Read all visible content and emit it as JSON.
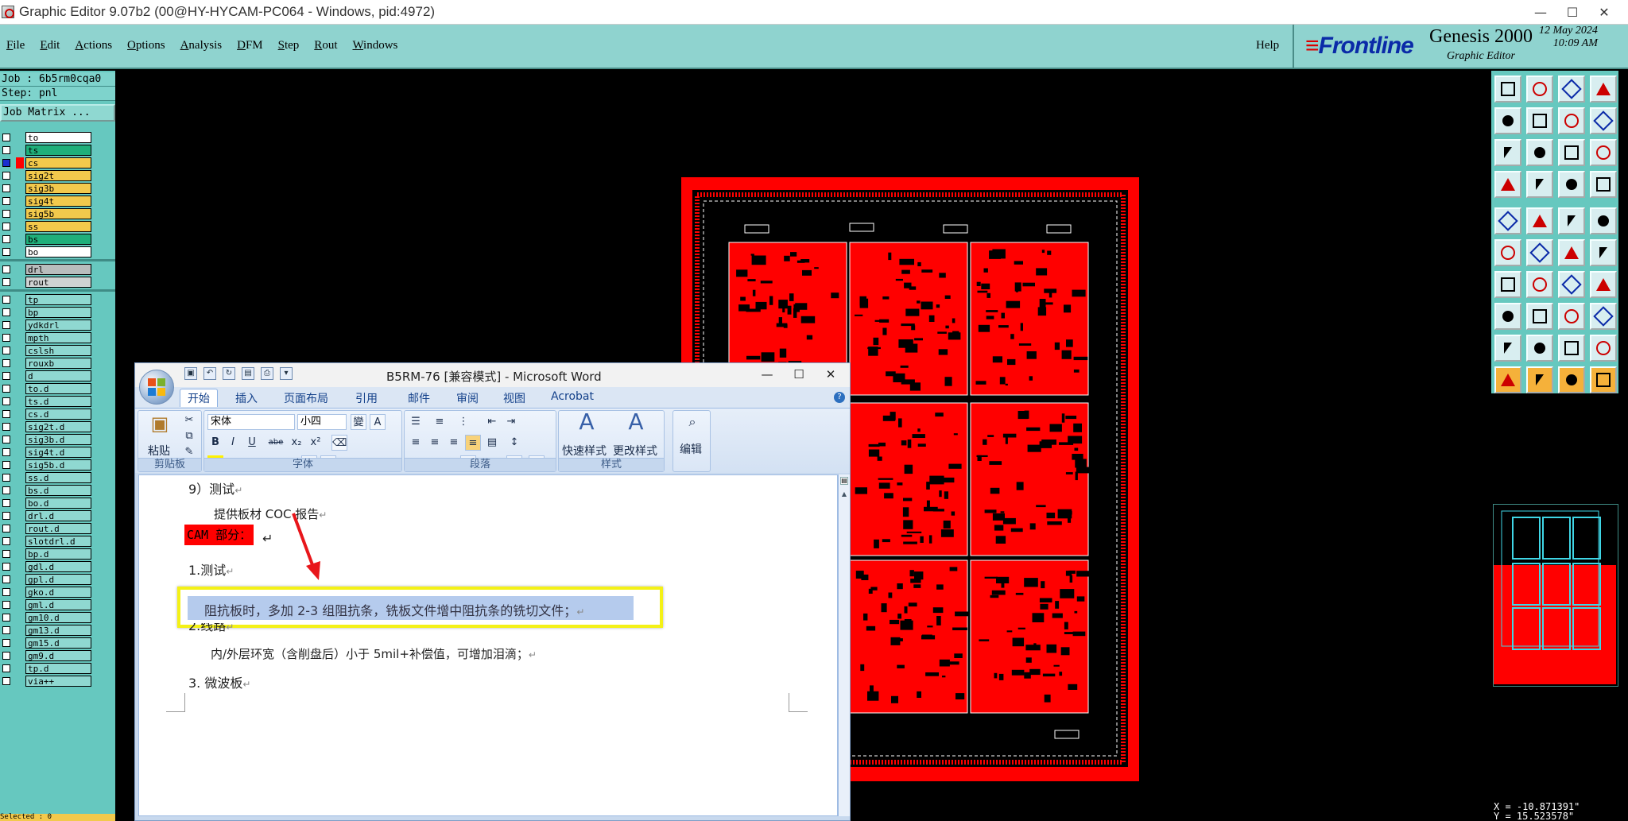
{
  "window": {
    "title": "Graphic Editor 9.07b2 (00@HY-HYCAM-PC064 - Windows, pid:4972)",
    "minimize": "—",
    "maximize": "☐",
    "close": "✕"
  },
  "menu": [
    "File",
    "Edit",
    "Actions",
    "Options",
    "Analysis",
    "DFM",
    "Step",
    "Rout",
    "Windows"
  ],
  "help": "Help",
  "brand": {
    "logo": "Frontline",
    "product": "Genesis 2000",
    "subtitle": "Graphic Editor",
    "date": "12 May 2024",
    "time": "10:09 AM"
  },
  "job": {
    "job_line": "Job : 6b5rm0cqa0",
    "step_line": "Step: pnl",
    "matrix_button": "Job Matrix ..."
  },
  "layers": [
    {
      "name": "to",
      "color": "#ffffff",
      "on": false
    },
    {
      "name": "ts",
      "color": "#1faf7a",
      "on": false
    },
    {
      "name": "cs",
      "color": "#f2c94c",
      "on": true,
      "marker": "#ff0000"
    },
    {
      "name": "sig2t",
      "color": "#f2c94c",
      "on": false
    },
    {
      "name": "sig3b",
      "color": "#f2c94c",
      "on": false
    },
    {
      "name": "sig4t",
      "color": "#f2c94c",
      "on": false
    },
    {
      "name": "sig5b",
      "color": "#f2c94c",
      "on": false
    },
    {
      "name": "ss",
      "color": "#f2c94c",
      "on": false
    },
    {
      "name": "bs",
      "color": "#1faf7a",
      "on": false
    },
    {
      "name": "bo",
      "color": "#ffffff",
      "on": false
    },
    {
      "name": "drl",
      "color": "#b9bdbd",
      "on": false
    },
    {
      "name": "rout",
      "color": "#cfd3d3",
      "on": false
    },
    {
      "name": "tp",
      "color": "#8fd8d1",
      "on": false
    },
    {
      "name": "bp",
      "color": "#8fd8d1",
      "on": false
    },
    {
      "name": "ydkdrl",
      "color": "#8fd8d1",
      "on": false
    },
    {
      "name": "mpth",
      "color": "#8fd8d1",
      "on": false
    },
    {
      "name": "cslsh",
      "color": "#8fd8d1",
      "on": false
    },
    {
      "name": "rouxb",
      "color": "#8fd8d1",
      "on": false
    },
    {
      "name": "d",
      "color": "#8fd8d1",
      "on": false
    },
    {
      "name": "to.d",
      "color": "#8fd8d1",
      "on": false
    },
    {
      "name": "ts.d",
      "color": "#8fd8d1",
      "on": false
    },
    {
      "name": "cs.d",
      "color": "#8fd8d1",
      "on": false
    },
    {
      "name": "sig2t.d",
      "color": "#8fd8d1",
      "on": false
    },
    {
      "name": "sig3b.d",
      "color": "#8fd8d1",
      "on": false
    },
    {
      "name": "sig4t.d",
      "color": "#8fd8d1",
      "on": false
    },
    {
      "name": "sig5b.d",
      "color": "#8fd8d1",
      "on": false
    },
    {
      "name": "ss.d",
      "color": "#8fd8d1",
      "on": false
    },
    {
      "name": "bs.d",
      "color": "#8fd8d1",
      "on": false
    },
    {
      "name": "bo.d",
      "color": "#8fd8d1",
      "on": false
    },
    {
      "name": "drl.d",
      "color": "#8fd8d1",
      "on": false
    },
    {
      "name": "rout.d",
      "color": "#8fd8d1",
      "on": false
    },
    {
      "name": "slotdrl.d",
      "color": "#8fd8d1",
      "on": false
    },
    {
      "name": "bp.d",
      "color": "#8fd8d1",
      "on": false
    },
    {
      "name": "gdl.d",
      "color": "#8fd8d1",
      "on": false
    },
    {
      "name": "gpl.d",
      "color": "#8fd8d1",
      "on": false
    },
    {
      "name": "gko.d",
      "color": "#8fd8d1",
      "on": false
    },
    {
      "name": "gml.d",
      "color": "#8fd8d1",
      "on": false
    },
    {
      "name": "gm10.d",
      "color": "#8fd8d1",
      "on": false
    },
    {
      "name": "gm13.d",
      "color": "#8fd8d1",
      "on": false
    },
    {
      "name": "gm15.d",
      "color": "#8fd8d1",
      "on": false
    },
    {
      "name": "gm9.d",
      "color": "#8fd8d1",
      "on": false
    },
    {
      "name": "tp.d",
      "color": "#8fd8d1",
      "on": false
    },
    {
      "name": "via++",
      "color": "#8fd8d1",
      "on": false
    }
  ],
  "selected_line": "Selected : 0",
  "coords": {
    "x": "X = -10.871391\"",
    "y": "Y = 15.523578\""
  },
  "toolbar_icons": [
    "home-icon",
    "open-icon",
    "house-icon",
    "window-icon",
    "import-icon",
    "export-icon",
    "input-icon",
    "script-icon",
    "zoom-fit-icon",
    "pan-icon",
    "scale-icon",
    "query-icon",
    "snap-icon",
    "grid-icon",
    "measure-icon",
    "measure-icon-2",
    "record-icon",
    "frame-icon",
    "film-icon",
    "dot-icon",
    "connect-icon",
    "cross-icon",
    "route-icon",
    "route-icon-2",
    "line-icon",
    "slash-icon",
    "arc-icon",
    "text-icon",
    "pad-icon",
    "minus-icon",
    "mirror-icon",
    "array-icon",
    "triangle-icon",
    "triangle-a-icon",
    "triangle-b-icon",
    "triangle-c-icon",
    "pointer-icon",
    "pointer-2-icon",
    "pointer-3-icon",
    "pointer-4-icon"
  ],
  "word": {
    "caption": "B5RM-76 [兼容模式] - Microsoft Word",
    "tabs": [
      "开始",
      "插入",
      "页面布局",
      "引用",
      "邮件",
      "审阅",
      "视图",
      "Acrobat"
    ],
    "groups": {
      "clipboard": "剪贴板",
      "font": "字体",
      "paragraph": "段落",
      "styles": "样式",
      "edit": "编辑"
    },
    "paste_label": "粘贴",
    "font_name": "宋体",
    "font_size": "小四",
    "quick_styles": "快速样式",
    "change_styles": "更改样式",
    "edit_label": "编辑",
    "format_buttons": [
      "B",
      "I",
      "U",
      "abe",
      "x₂",
      "x²"
    ],
    "doc": {
      "line1": "9）测试",
      "line2": "提供板材 COC 报告",
      "cam": "CAM 部分：",
      "line3": "1.测试",
      "highlight": "阻抗板时，多加 2-3 组阻抗条，铣板文件增中阻抗条的铣切文件；",
      "line4": "2.线路",
      "line5": "内/外层环宽（含削盘后）小于 5mil+补偿值，可增加泪滴；",
      "line6": "3.  微波板"
    },
    "colors": {
      "highlight_box": "#f4f116",
      "selection": "#b5cbed",
      "cam_tag": "#ff0000",
      "arrow": "#e8161b"
    }
  },
  "colors": {
    "menubar": "#8fd3cf",
    "panel": "#66c8bf",
    "pcb_copper": "#ff0000",
    "minimap_outline": "#3fd6e6"
  }
}
